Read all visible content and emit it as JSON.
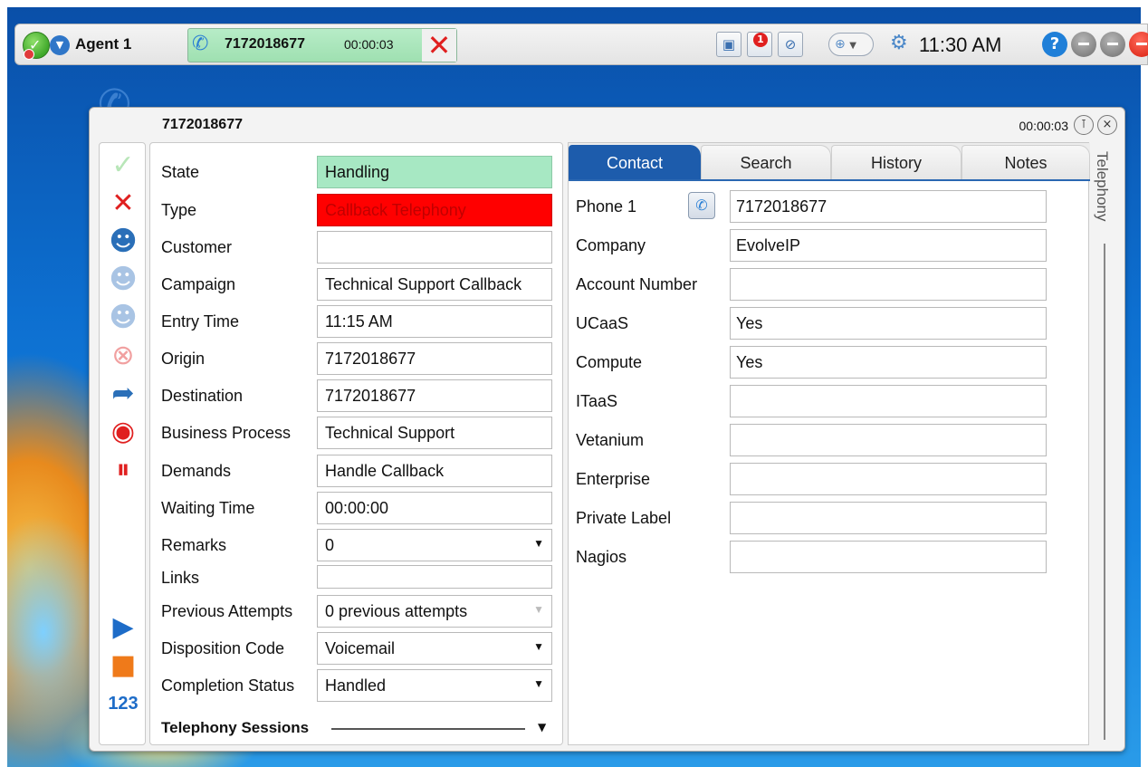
{
  "topbar": {
    "agent_label": "Agent 1",
    "call_number": "7172018677",
    "call_timer": "00:00:03",
    "notification_count": "1",
    "clock": "11:30 AM",
    "help_label": "?"
  },
  "window": {
    "title": "7172018677",
    "timer": "00:00:03"
  },
  "left_tools": {
    "counter_label": "123"
  },
  "form": {
    "rows": [
      {
        "label": "State",
        "value": "Handling"
      },
      {
        "label": "Type",
        "value": "Callback Telephony"
      },
      {
        "label": "Customer",
        "value": ""
      },
      {
        "label": "Campaign",
        "value": "Technical Support Callback"
      },
      {
        "label": "Entry Time",
        "value": "11:15 AM"
      },
      {
        "label": "Origin",
        "value": "7172018677"
      },
      {
        "label": "Destination",
        "value": "7172018677"
      },
      {
        "label": "Business Process",
        "value": "Technical Support"
      },
      {
        "label": "Demands",
        "value": "Handle Callback"
      },
      {
        "label": "Waiting Time",
        "value": "00:00:00"
      },
      {
        "label": "Remarks",
        "value": "0"
      },
      {
        "label": "Links",
        "value": ""
      },
      {
        "label": "Previous Attempts",
        "value": "0 previous attempts"
      },
      {
        "label": "Disposition Code",
        "value": "Voicemail"
      },
      {
        "label": "Completion Status",
        "value": "Handled"
      }
    ],
    "telephony_sessions": "Telephony Sessions"
  },
  "tabs": [
    "Contact",
    "Search",
    "History",
    "Notes"
  ],
  "side_tab": "Telephony",
  "contact": {
    "rows": [
      {
        "label": "Phone 1",
        "value": "7172018677"
      },
      {
        "label": "Company",
        "value": "EvolveIP"
      },
      {
        "label": "Account Number",
        "value": ""
      },
      {
        "label": "UCaaS",
        "value": "Yes"
      },
      {
        "label": "Compute",
        "value": "Yes"
      },
      {
        "label": "ITaaS",
        "value": ""
      },
      {
        "label": "Vetanium",
        "value": ""
      },
      {
        "label": "Enterprise",
        "value": ""
      },
      {
        "label": "Private Label",
        "value": ""
      },
      {
        "label": "Nagios",
        "value": ""
      }
    ]
  },
  "colors": {
    "state_green": "#a7e8c3",
    "type_red": "#ff0000",
    "tab_active": "#1d5cac"
  }
}
